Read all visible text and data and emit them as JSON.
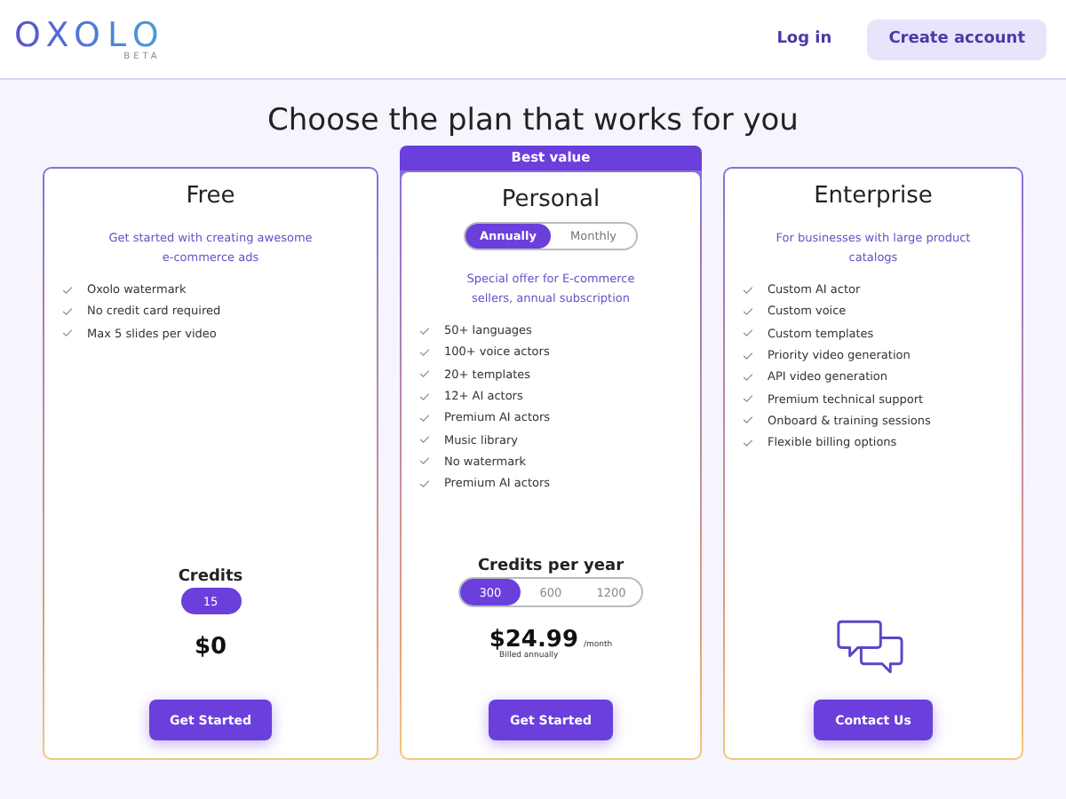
{
  "header": {
    "logo": "OXOLO",
    "logo_tag": "BETA",
    "login": "Log in",
    "create_account": "Create account"
  },
  "heading": "Choose the plan that works for you",
  "plans": [
    {
      "kind": "single",
      "name": "Free",
      "subtitle": "Get started with creating awesome e-commerce ads",
      "features": [
        "Oxolo watermark",
        "No credit card required",
        "Max 5 slides per video"
      ],
      "credits_label": "Credits",
      "credit_options": [
        {
          "label": "15",
          "selected": true
        }
      ],
      "price": "$0",
      "button": "Get Started"
    },
    {
      "kind": "options",
      "badge": "Best value",
      "name": "Personal",
      "billing": [
        {
          "label": "Annually",
          "selected": true
        },
        {
          "label": "Monthly",
          "selected": false
        }
      ],
      "subtitle": "Special offer for E-commerce sellers, annual subscription",
      "features": [
        "50+ languages",
        "100+ voice actors",
        "20+ templates",
        "12+ AI actors",
        "Premium AI actors",
        "Music library",
        "No watermark",
        "Premium AI actors"
      ],
      "credits_label": "Credits per year",
      "credit_options": [
        {
          "label": "300",
          "selected": true
        },
        {
          "label": "600",
          "selected": false
        },
        {
          "label": "1200",
          "selected": false
        }
      ],
      "price": "$24.99",
      "period": "/month",
      "price_note": "Billed annually",
      "button": "Get Started"
    },
    {
      "kind": "contact",
      "name": "Enterprise",
      "subtitle": "For businesses with large product catalogs",
      "features": [
        "Custom AI actor",
        "Custom voice",
        "Custom templates",
        "Priority video generation",
        "API video generation",
        "Premium technical support",
        "Onboard & training sessions",
        "Flexible billing options"
      ],
      "button": "Contact Us"
    }
  ]
}
